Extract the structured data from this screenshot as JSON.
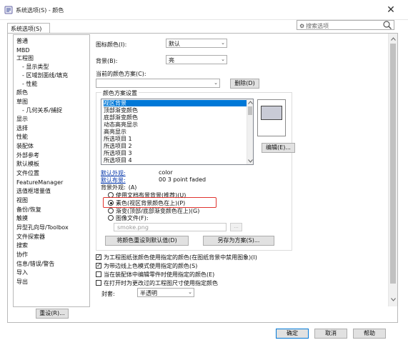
{
  "window": {
    "title": "系统选项(S) - 颜色",
    "close_glyph": "✕"
  },
  "tab": {
    "label": "系统选项(S)"
  },
  "search": {
    "placeholder": "搜索选项"
  },
  "nav": {
    "items": [
      "普通",
      "MBD",
      "工程图",
      "- 显示类型",
      "- 区域剖面线/填充",
      "- 性能",
      "颜色",
      "草图",
      "- 几何关系/捕捉",
      "显示",
      "选择",
      "性能",
      "装配体",
      "外部参考",
      "默认模板",
      "文件位置",
      "FeatureManager",
      "选值框增量值",
      "视图",
      "备份/恢复",
      "触摸",
      "异型孔向导/Toolbox",
      "文件探索器",
      "搜索",
      "协作",
      "信息/错误/警告",
      "导入",
      "导出"
    ],
    "reset_label": "重设(R)..."
  },
  "settings": {
    "icon_color_label": "图标颜色(I):",
    "icon_color_value": "默认",
    "background_label": "背景(B):",
    "background_value": "亮",
    "current_scheme_label": "当前的颜色方案(C):",
    "current_scheme_value": "",
    "delete_label": "删除(D)"
  },
  "scheme": {
    "group_title": "颜色方案设置",
    "items": [
      "视区背景",
      "顶部渐变颜色",
      "底部渐变颜色",
      "动态高亮显示",
      "高亮显示",
      "所选项目 1",
      "所选项目 2",
      "所选项目 3",
      "所选项目 4"
    ],
    "selected_index": 0,
    "edit_label": "编辑(E)...",
    "default_appearance_link": "默认外观:",
    "default_appearance_value": "color",
    "default_scene_link": "默认布景:",
    "default_scene_value": "00 3 point faded",
    "bg_appearance_label": "背景外观:",
    "bg_appearance_hint": "(A)",
    "radio_options": [
      "使用文档布景背景(推荐)(U)",
      "素色(视区背景颜色在上)(P)",
      "渐变(顶部/底部渐变颜色在上)(G)",
      "图像文件(F):"
    ],
    "radio_selected": 1,
    "image_file_value": "smoke.png",
    "browse_label": "...",
    "reset_colors_label": "将颜色重设到默认值(D)",
    "save_as_label": "另存为方案(S)..."
  },
  "options": {
    "checkboxes": [
      {
        "label": "为工程图纸张颜色使用指定的颜色(在图纸背景中禁用图象)(I)",
        "checked": true
      },
      {
        "label": "为带边线上色模式使用指定的颜色(S)",
        "checked": true
      },
      {
        "label": "当在装配体中编辑零件时使用指定的颜色(E)",
        "checked": false
      },
      {
        "label": "在打开时为更改过的工程图尺寸使用指定颜色",
        "checked": false
      }
    ],
    "envelope_label": "封套:",
    "envelope_value": "半透明"
  },
  "footer": {
    "ok": "确定",
    "cancel": "取消",
    "help": "帮助"
  }
}
